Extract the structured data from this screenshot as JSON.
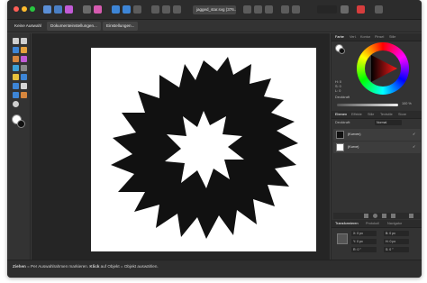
{
  "titlebar": {
    "document_tab": "jagged_star.svg (376..."
  },
  "context_bar": {
    "no_selection": "Keine Auswahl",
    "document_settings": "Dokumenteinstellungen...",
    "settings": "Einstellungen..."
  },
  "right_panel": {
    "color_tabs": [
      "Farbe",
      "Verl.",
      "Kontur",
      "Pinsel",
      "Stile"
    ],
    "color_values": [
      "H: 0",
      "S: 0",
      "L: 0"
    ],
    "opacity_label": "Deckkraft",
    "opacity_value": "100 %",
    "layer_tabs": [
      "Ebenen",
      "Effekte",
      "Stile",
      "Textstile",
      "Store"
    ],
    "layer_opacity_label": "Deckkraft:",
    "layer_blend": "Normal",
    "layers": [
      {
        "name": "(Kurven)"
      },
      {
        "name": "(Kurve)"
      }
    ],
    "transform_tabs": [
      "Transformieren",
      "Protokoll",
      "Navigator"
    ],
    "transform_fields": [
      {
        "label": "X:",
        "value": "0 px"
      },
      {
        "label": "B:",
        "value": "0 px"
      },
      {
        "label": "Y:",
        "value": "0 px"
      },
      {
        "label": "H:",
        "value": "0 px"
      },
      {
        "label": "R:",
        "value": "0 °"
      },
      {
        "label": "S:",
        "value": "0 °"
      }
    ]
  },
  "status": {
    "drag_label": "Ziehen",
    "drag_text": " = Per Auswahlrahmen markieren. ",
    "click_label": "Klick",
    "click_text": " auf Objekt = Objekt auswählen."
  }
}
